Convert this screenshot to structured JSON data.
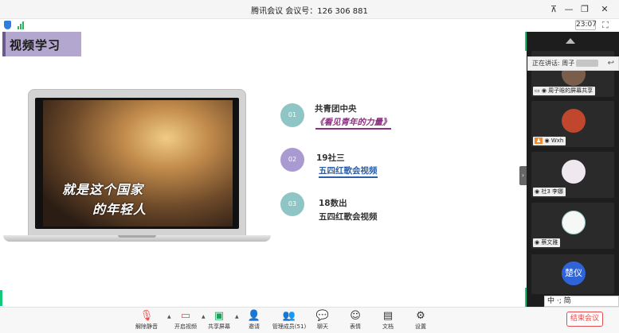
{
  "window": {
    "title": "腾讯会议 会议号：126 306 881",
    "controls": [
      "pin-icon",
      "minimize-icon",
      "restore-icon",
      "close-icon"
    ]
  },
  "infobar": {
    "timer": "23:07",
    "icons": [
      "security-shield-icon",
      "network-signal-icon",
      "fullscreen-icon"
    ]
  },
  "slide": {
    "heading": "视频学习",
    "video_caption_line1": "就是这个国家",
    "video_caption_line2": "的年轻人",
    "agenda": [
      {
        "num": "01",
        "title": "共青团中央",
        "sub": "《看见青年的力量》",
        "color": "#8fc6c5"
      },
      {
        "num": "02",
        "title": "19社三",
        "sub": "五四红歌会视频",
        "color": "#a99bd1"
      },
      {
        "num": "03",
        "title": "18数出",
        "sub": "五四红歌会视频",
        "color": "#8fc6c5"
      }
    ]
  },
  "right_panel": {
    "speaking_label": "正在讲话: 周子",
    "tiles": [
      {
        "name": "周子晗的屏幕共享"
      },
      {
        "name": "Wxh"
      },
      {
        "name": "社3 李娜"
      },
      {
        "name": "蔡文雅"
      },
      {
        "name": "楚仪",
        "avatar_text": "楚仪"
      }
    ],
    "ime_text": "中 ·; 简"
  },
  "toolbar": {
    "buttons": [
      {
        "label": "解除静音",
        "icon": "microphone-muted-icon"
      },
      {
        "label": "开启视频",
        "icon": "camera-off-icon"
      },
      {
        "label": "共享屏幕",
        "icon": "share-screen-icon"
      },
      {
        "label": "邀请",
        "icon": "invite-icon"
      },
      {
        "label": "管理成员(51)",
        "icon": "members-icon"
      },
      {
        "label": "聊天",
        "icon": "chat-icon"
      },
      {
        "label": "表情",
        "icon": "emoji-icon"
      },
      {
        "label": "文档",
        "icon": "document-icon"
      },
      {
        "label": "设置",
        "icon": "settings-icon"
      }
    ],
    "end_label": "结束会议"
  }
}
